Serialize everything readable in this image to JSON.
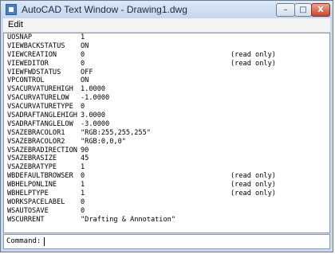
{
  "window": {
    "title": "AutoCAD Text Window - Drawing1.dwg",
    "buttons": {
      "minimize": "–",
      "maximize": "□",
      "close": "X"
    }
  },
  "menu": {
    "items": [
      "Edit"
    ]
  },
  "variables": [
    {
      "name": "UOSNAP",
      "value": "1",
      "note": ""
    },
    {
      "name": "VIEWBACKSTATUS",
      "value": "ON",
      "note": ""
    },
    {
      "name": "VIEWCREATION",
      "value": "0",
      "note": "(read only)"
    },
    {
      "name": "VIEWEDITOR",
      "value": "0",
      "note": "(read only)"
    },
    {
      "name": "VIEWFWDSTATUS",
      "value": "OFF",
      "note": ""
    },
    {
      "name": "VPCONTROL",
      "value": "ON",
      "note": ""
    },
    {
      "name": "VSACURVATUREHIGH",
      "value": "1.0000",
      "note": ""
    },
    {
      "name": "VSACURVATURELOW",
      "value": "-1.0000",
      "note": ""
    },
    {
      "name": "VSACURVATURETYPE",
      "value": "0",
      "note": ""
    },
    {
      "name": "VSADRAFTANGLEHIGH",
      "value": "3.0000",
      "note": ""
    },
    {
      "name": "VSADRAFTANGLELOW",
      "value": "-3.0000",
      "note": ""
    },
    {
      "name": "VSAZEBRACOLOR1",
      "value": "\"RGB:255,255,255\"",
      "note": ""
    },
    {
      "name": "VSAZEBRACOLOR2",
      "value": "\"RGB:0,0,0\"",
      "note": ""
    },
    {
      "name": "VSAZEBRADIRECTION",
      "value": "90",
      "note": ""
    },
    {
      "name": "VSAZEBRASIZE",
      "value": "45",
      "note": ""
    },
    {
      "name": "VSAZEBRATYPE",
      "value": "1",
      "note": ""
    },
    {
      "name": "WBDEFAULTBROWSER",
      "value": "0",
      "note": "(read only)"
    },
    {
      "name": "WBHELPONLINE",
      "value": "1",
      "note": "(read only)"
    },
    {
      "name": "WBHELPTYPE",
      "value": "1",
      "note": "(read only)"
    },
    {
      "name": "WORKSPACELABEL",
      "value": "0",
      "note": ""
    },
    {
      "name": "WSAUTOSAVE",
      "value": "0",
      "note": ""
    },
    {
      "name": "WSCURRENT",
      "value": "\"Drafting & Annotation\"",
      "note": ""
    }
  ],
  "command": {
    "prompt": "Command:"
  }
}
